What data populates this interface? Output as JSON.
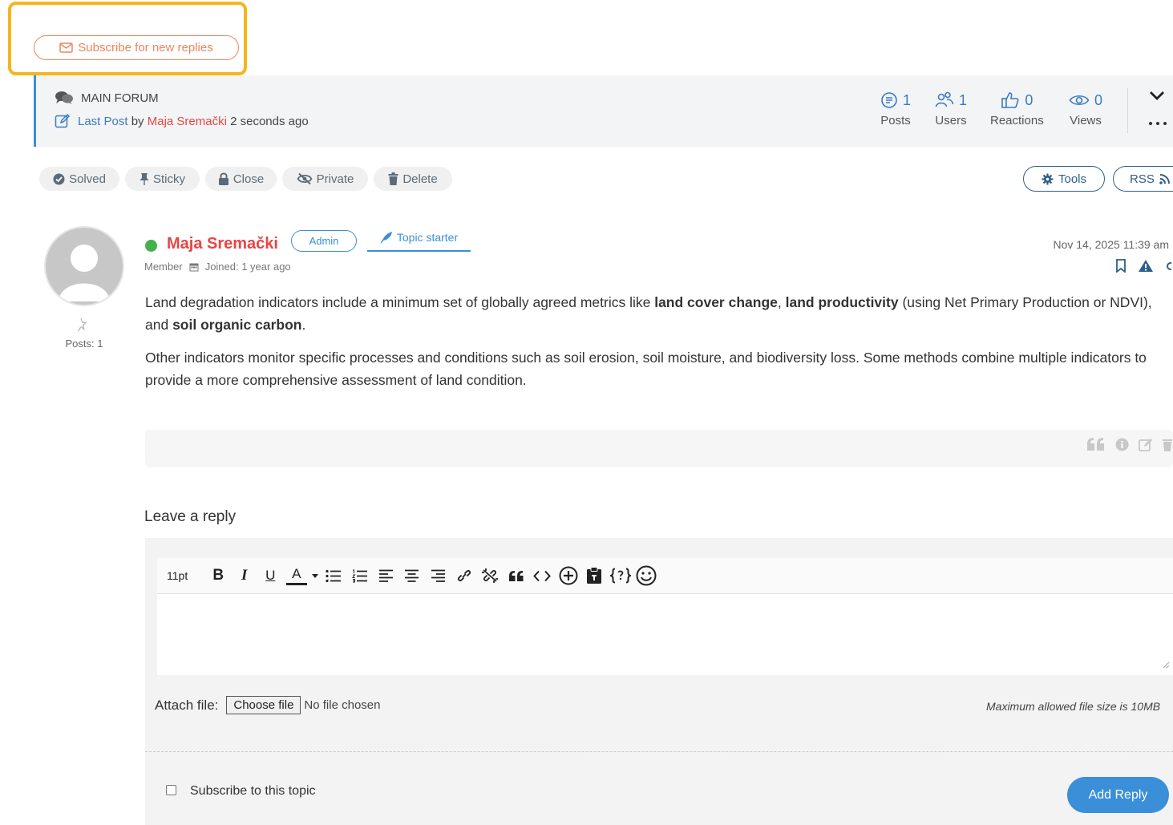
{
  "subscribe": {
    "label": "Subscribe for new replies"
  },
  "forum": {
    "name": "MAIN FORUM",
    "last_post_prefix": "Last Post",
    "by": "by",
    "author": "Maja Sremački",
    "time": "2 seconds ago"
  },
  "stats": [
    {
      "icon": "posts-icon",
      "value": "1",
      "label": "Posts"
    },
    {
      "icon": "users-icon",
      "value": "1",
      "label": "Users"
    },
    {
      "icon": "reactions-icon",
      "value": "0",
      "label": "Reactions"
    },
    {
      "icon": "views-icon",
      "value": "0",
      "label": "Views"
    }
  ],
  "actions": {
    "solved": "Solved",
    "sticky": "Sticky",
    "close": "Close",
    "private": "Private",
    "delete": "Delete",
    "tools": "Tools",
    "rss": "RSS"
  },
  "post": {
    "author": "Maja Sremački",
    "badge": "Admin",
    "topic_starter": "Topic starter",
    "role": "Member",
    "joined": "Joined: 1 year ago",
    "posts": "Posts: 1",
    "date": "Nov 14, 2025 11:39 am",
    "p1_a": "Land degradation indicators include a minimum set of globally agreed metrics like ",
    "p1_b": "land cover change",
    "p1_c": ", ",
    "p1_d": "land productivity",
    "p1_e": " (using Net Primary Production or NDVI), and ",
    "p1_f": "soil organic carbon",
    "p1_g": ".",
    "p2": "Other indicators monitor specific processes and conditions such as soil erosion, soil moisture, and biodiversity loss. Some methods combine multiple indicators to provide a more comprehensive assessment of land condition."
  },
  "reply": {
    "title": "Leave a reply",
    "font_size": "11pt",
    "attach_label": "Attach file:",
    "choose_file": "Choose file",
    "no_file": "No file chosen",
    "max_size": "Maximum allowed file size is 10MB",
    "subscribe_topic": "Subscribe to this topic",
    "add_reply": "Add Reply"
  },
  "colors": {
    "accent": "#3a8fd8",
    "author": "#e84545",
    "subscribe": "#f0845c",
    "highlight": "#f5b51c",
    "online": "#47b04b"
  }
}
